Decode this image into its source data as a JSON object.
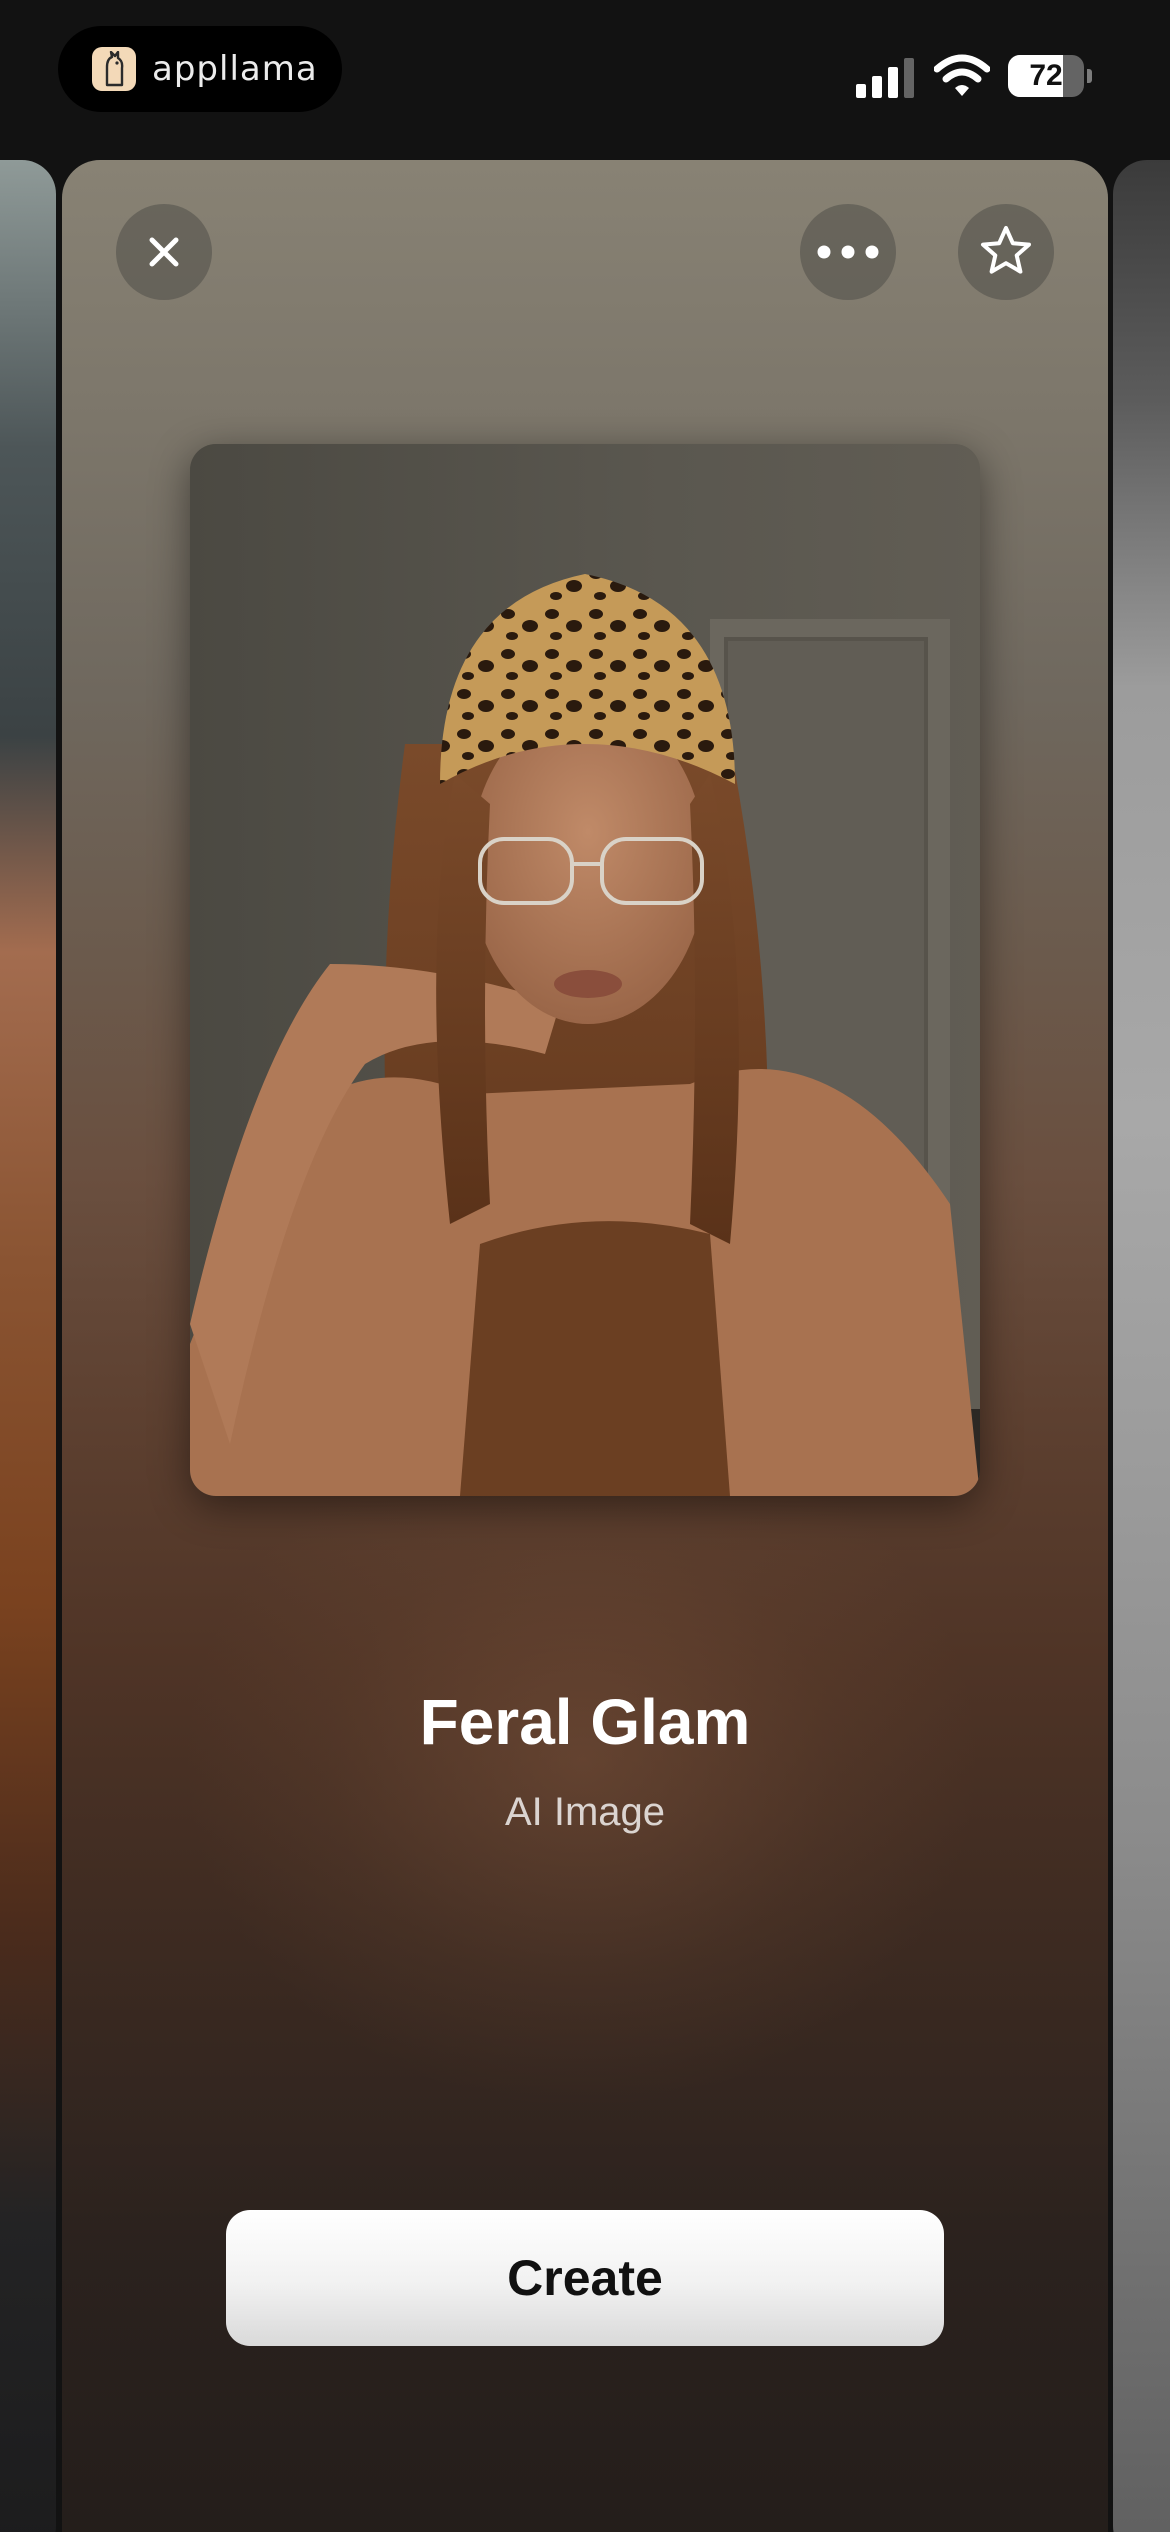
{
  "status_bar": {
    "app_name": "appllama",
    "battery_level": "72",
    "battery_fraction": 0.72,
    "icons": [
      "app-logo-icon",
      "signal-icon",
      "wifi-icon",
      "battery-icon"
    ]
  },
  "card": {
    "title": "Feral Glam",
    "subtitle": "AI Image",
    "create_label": "Create",
    "buttons": [
      "close-icon",
      "more-icon",
      "star-icon"
    ]
  },
  "colors": {
    "accent_button": "#ffffff",
    "background": "#121212"
  }
}
